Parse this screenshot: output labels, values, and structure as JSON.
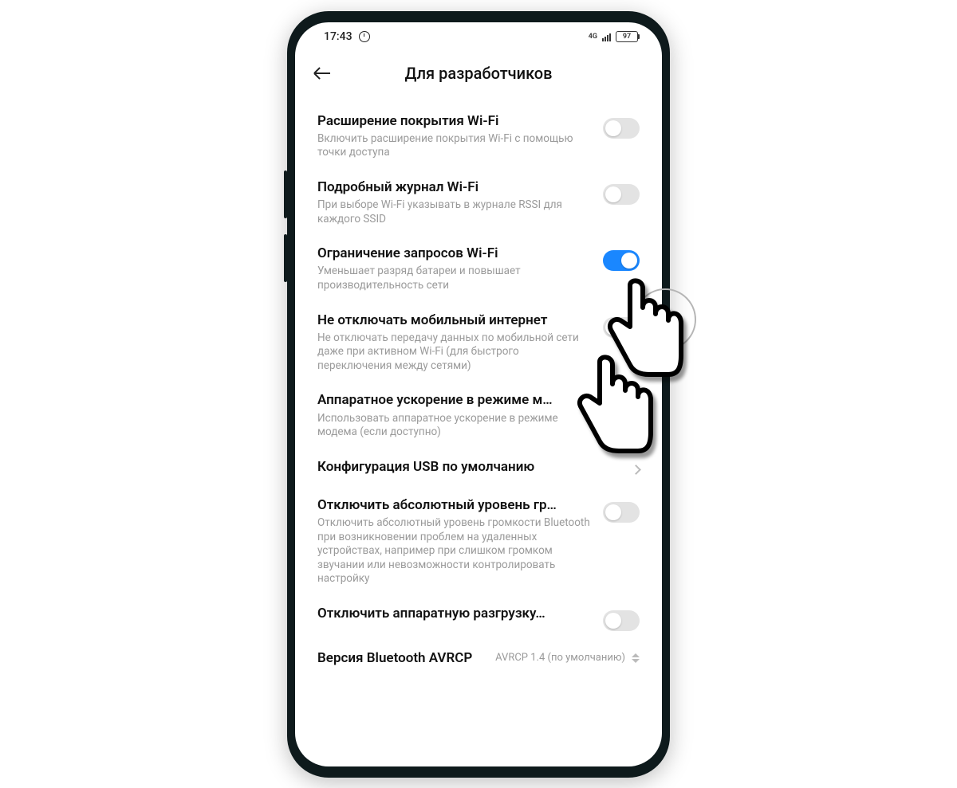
{
  "statusbar": {
    "time": "17:43",
    "net_label": "4G",
    "battery": "97"
  },
  "header": {
    "title": "Для разработчиков"
  },
  "items": [
    {
      "title": "Расширение покрытия Wi-Fi",
      "desc": "Включить расширение покрытия Wi-Fi с помощью точки доступа",
      "type": "toggle",
      "on": false
    },
    {
      "title": "Подробный журнал Wi-Fi",
      "desc": "При выборе Wi-Fi указывать в журнале RSSI для каждого SSID",
      "type": "toggle",
      "on": false
    },
    {
      "title": "Ограничение запросов Wi-Fi",
      "desc": "Уменьшает разряд батареи и повышает производительность сети",
      "type": "toggle",
      "on": true
    },
    {
      "title": "Не отключать мобильный интернет",
      "desc": "Не отключать передачу данных по мобильной сети даже при активном Wi-Fi (для быстрого переключения между сетями)",
      "type": "toggle",
      "on": false
    },
    {
      "title": "Аппаратное ускорение в режиме м…",
      "desc": "Использовать аппаратное ускорение в режиме модема (если доступно)",
      "type": "toggle",
      "on": false
    },
    {
      "title": "Конфигурация USB по умолчанию",
      "desc": "",
      "type": "nav"
    },
    {
      "title": "Отключить абсолютный уровень гр…",
      "desc": "Отключить абсолютный уровень громкости Bluetooth при возникновении проблем на удаленных устройствах, например при слишком громком звучании или невозможности контролировать настройку",
      "type": "toggle",
      "on": false
    },
    {
      "title": "Отключить аппаратную разгрузку…",
      "desc": "",
      "type": "toggle",
      "on": false
    },
    {
      "title": "Версия Bluetooth AVRCP",
      "desc": "",
      "type": "select",
      "value": "AVRCP 1.4 (по умолчанию)"
    }
  ]
}
